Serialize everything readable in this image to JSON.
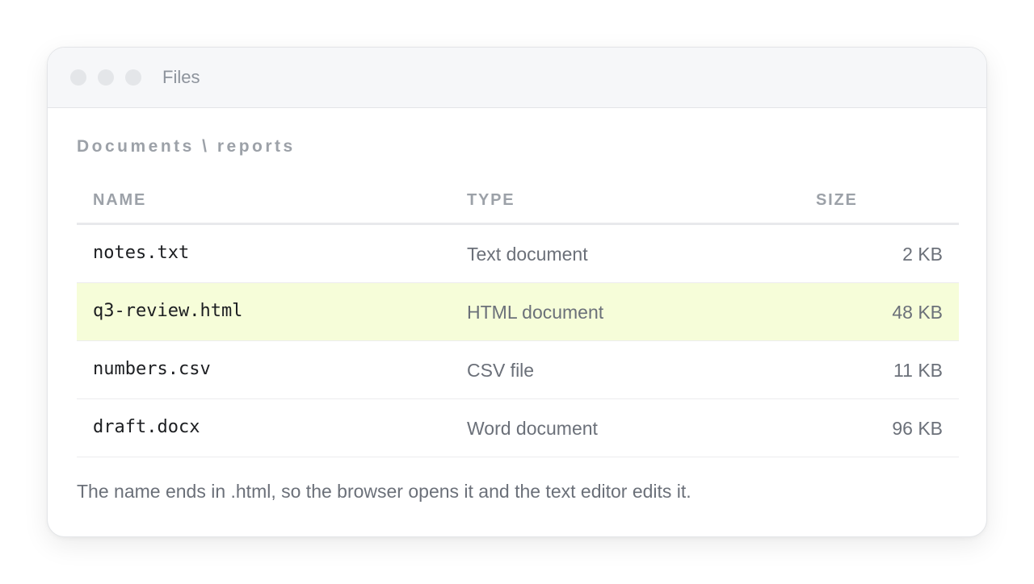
{
  "window": {
    "title": "Files",
    "controls": [
      "close",
      "minimize",
      "maximize"
    ]
  },
  "breadcrumb": "Documents \\ reports",
  "table": {
    "headers": {
      "name": "NAME",
      "type": "TYPE",
      "size": "SIZE"
    },
    "rows": [
      {
        "name": "notes.txt",
        "type": "Text document",
        "size": "2 KB",
        "highlighted": false
      },
      {
        "name": "q3-review.html",
        "type": "HTML document",
        "size": "48 KB",
        "highlighted": true
      },
      {
        "name": "numbers.csv",
        "type": "CSV file",
        "size": "11 KB",
        "highlighted": false
      },
      {
        "name": "draft.docx",
        "type": "Word document",
        "size": "96 KB",
        "highlighted": false
      }
    ]
  },
  "note": "The name ends in .html, so the browser opens it and the text editor edits it.",
  "colors": {
    "highlight_row": "#f6fdd9",
    "titlebar": "#f6f7f9",
    "window_dot": "#e4e6e9"
  }
}
